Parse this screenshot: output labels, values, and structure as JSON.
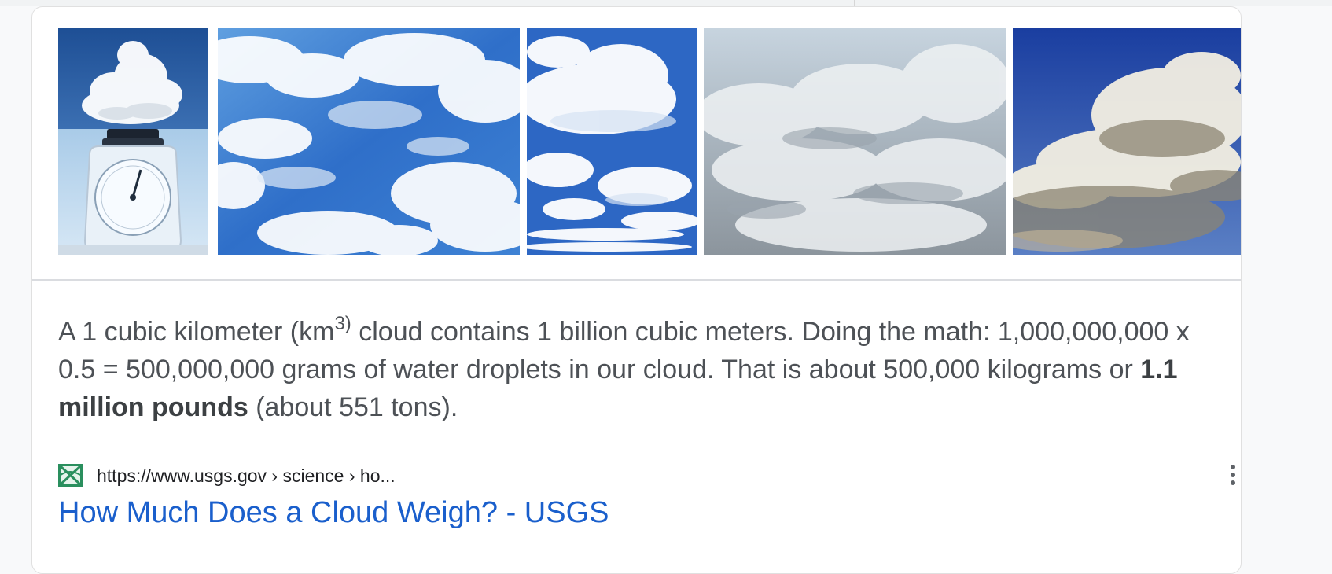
{
  "images": [
    {
      "name": "cloud-on-scale-image"
    },
    {
      "name": "blue-sky-clouds-image"
    },
    {
      "name": "cumulus-clouds-image"
    },
    {
      "name": "grey-cloudscape-image"
    },
    {
      "name": "storm-cloud-image"
    }
  ],
  "snippet": {
    "part1": "A 1 cubic kilometer (km",
    "sup": "3)",
    "part2": " cloud contains 1 billion cubic meters. Doing the math: 1,000,000,000 x 0.5 = 500,000,000 grams of water droplets in our cloud. That is about 500,000 kilograms or ",
    "bold": "1.1 million pounds",
    "part3": " (about 551 tons)."
  },
  "source": {
    "favicon": "usgs-favicon",
    "url": "https://www.usgs.gov › science › ho...",
    "more_icon": "more-vertical-icon"
  },
  "result": {
    "title": "How Much Does a Cloud Weigh? - USGS"
  },
  "colors": {
    "link": "#1a5fcc",
    "text": "#4d5156",
    "sky": "#2f6fc9",
    "favicon": "#2a8f5e"
  }
}
